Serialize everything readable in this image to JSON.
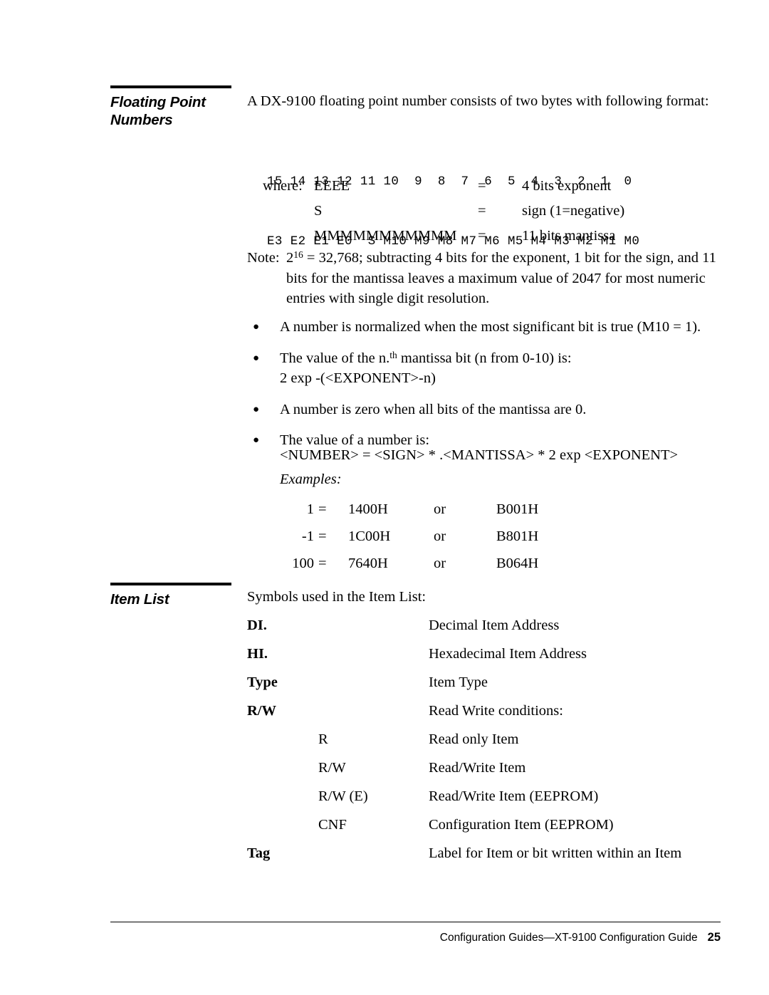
{
  "sections": [
    {
      "title_line1": "Floating Point",
      "title_line2": "Numbers"
    },
    {
      "title_line1": "Item List",
      "title_line2": ""
    }
  ],
  "floating_point": {
    "intro": "A DX-9100 floating point number consists of two bytes with following format:",
    "bit_table": {
      "row_bits": "15 14 13 12 11 10  9  8  7  6  5  4  3  2  1  0",
      "row_names": "E3 E2 E1 E0  S M10 M9 M8 M7 M6 M5 M4 M3 M2 M1 M0"
    },
    "where_label": "where:",
    "where_rows": [
      {
        "symbol": "EEEE",
        "eq": "=",
        "definition": "4 bits exponent"
      },
      {
        "symbol": "S",
        "eq": "=",
        "definition": "sign (1=negative)"
      },
      {
        "symbol": "MMMMMMMMMMM",
        "eq": "=",
        "definition": "11 bits mantissa"
      }
    ],
    "note": {
      "label": "Note:",
      "base": "2",
      "exponent": "16",
      "text_after": " = 32,768; subtracting 4 bits for the exponent, 1 bit for the sign, and 11 bits for the mantissa leaves a maximum value of 2047 for most numeric entries with single digit resolution."
    },
    "bullets": [
      {
        "text": "A number is normalized when the most significant bit is true (M10 = 1)."
      },
      {
        "text_before": "The value of the n.",
        "sup": "th",
        "text_after": " mantissa bit (n from 0-10) is:",
        "second_line": "2 exp -(<EXPONENT>-n)"
      },
      {
        "text": "A number is zero when all bits of the mantissa are 0."
      },
      {
        "text": "The value of a number is:"
      }
    ],
    "number_formula": "<NUMBER> = <SIGN> * .<MANTISSA> * 2 exp <EXPONENT>",
    "examples_label": "Examples:",
    "examples": [
      {
        "value": "1",
        "eq": "=",
        "hex1": "1400H",
        "or": "or",
        "hex2": "B001H"
      },
      {
        "value": "-1",
        "eq": "=",
        "hex1": "1C00H",
        "or": "or",
        "hex2": "B801H"
      },
      {
        "value": "100",
        "eq": "=",
        "hex1": "7640H",
        "or": "or",
        "hex2": "B064H"
      }
    ]
  },
  "item_list": {
    "intro": "Symbols used in the Item List:",
    "symbols": [
      {
        "key": "DI.",
        "value": "Decimal Item Address"
      },
      {
        "key": "HI.",
        "value": "Hexadecimal Item Address"
      },
      {
        "key": "Type",
        "value": "Item Type"
      },
      {
        "key": "R/W",
        "value": "Read Write conditions:"
      }
    ],
    "rw_conditions": [
      {
        "key": "R",
        "value": "Read only Item"
      },
      {
        "key": "R/W",
        "value": "Read/Write Item"
      },
      {
        "key": "R/W (E)",
        "value": "Read/Write Item (EEPROM)"
      },
      {
        "key": "CNF",
        "value": "Configuration Item (EEPROM)"
      }
    ],
    "tag": {
      "key": "Tag",
      "value": "Label for Item or bit written within an Item"
    }
  },
  "footer": {
    "text": "Configuration Guides—XT-9100 Configuration Guide",
    "page": "25"
  }
}
